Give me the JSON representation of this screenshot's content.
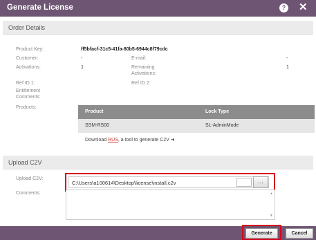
{
  "dialog": {
    "title": "Generate License",
    "help_icon": "?",
    "close_icon": "✕"
  },
  "order_details": {
    "header": "Order Details",
    "product_key_label": "Product Key:",
    "product_key_value": "ff5bfacf-31c5-41fa-80b5-6944c8f79cdc",
    "customer_label": "Customer:",
    "customer_value": "-",
    "email_label": "E-mail:",
    "email_value": "-",
    "activations_label": "Activations:",
    "activations_value": "1",
    "remaining_label_1": "Remaining",
    "remaining_label_2": "Activations:",
    "remaining_value": "1",
    "ref1_label": "Ref ID 1:",
    "ref2_label": "Ref ID 2:",
    "entitlement_label_1": "Entitlement",
    "entitlement_label_2": "Comments:",
    "products_label": "Products:",
    "table": {
      "columns": [
        "Product",
        "Lock Type"
      ],
      "rows": [
        [
          "SSM-RS00",
          "SL-AdminMode"
        ]
      ]
    },
    "download": {
      "prefix": "Download",
      "link": "RUS",
      "suffix": ", a tool to generate C2V",
      "arrow": "➜"
    }
  },
  "upload_c2v": {
    "header": "Upload C2V",
    "upload_label": "Upload C2V:",
    "file_path": "C:\\Users\\a100614\\Desktop\\license\\install.c2v",
    "browse_label": "...",
    "comments_label": "Comments:",
    "scroll_up": "▲",
    "scroll_down": "▼"
  },
  "footer": {
    "generate_label": "Generate",
    "cancel_label": "Cancel"
  },
  "colors": {
    "titlebar": "#6e5573",
    "highlight": "#d6001c",
    "link": "#d23b2a"
  }
}
